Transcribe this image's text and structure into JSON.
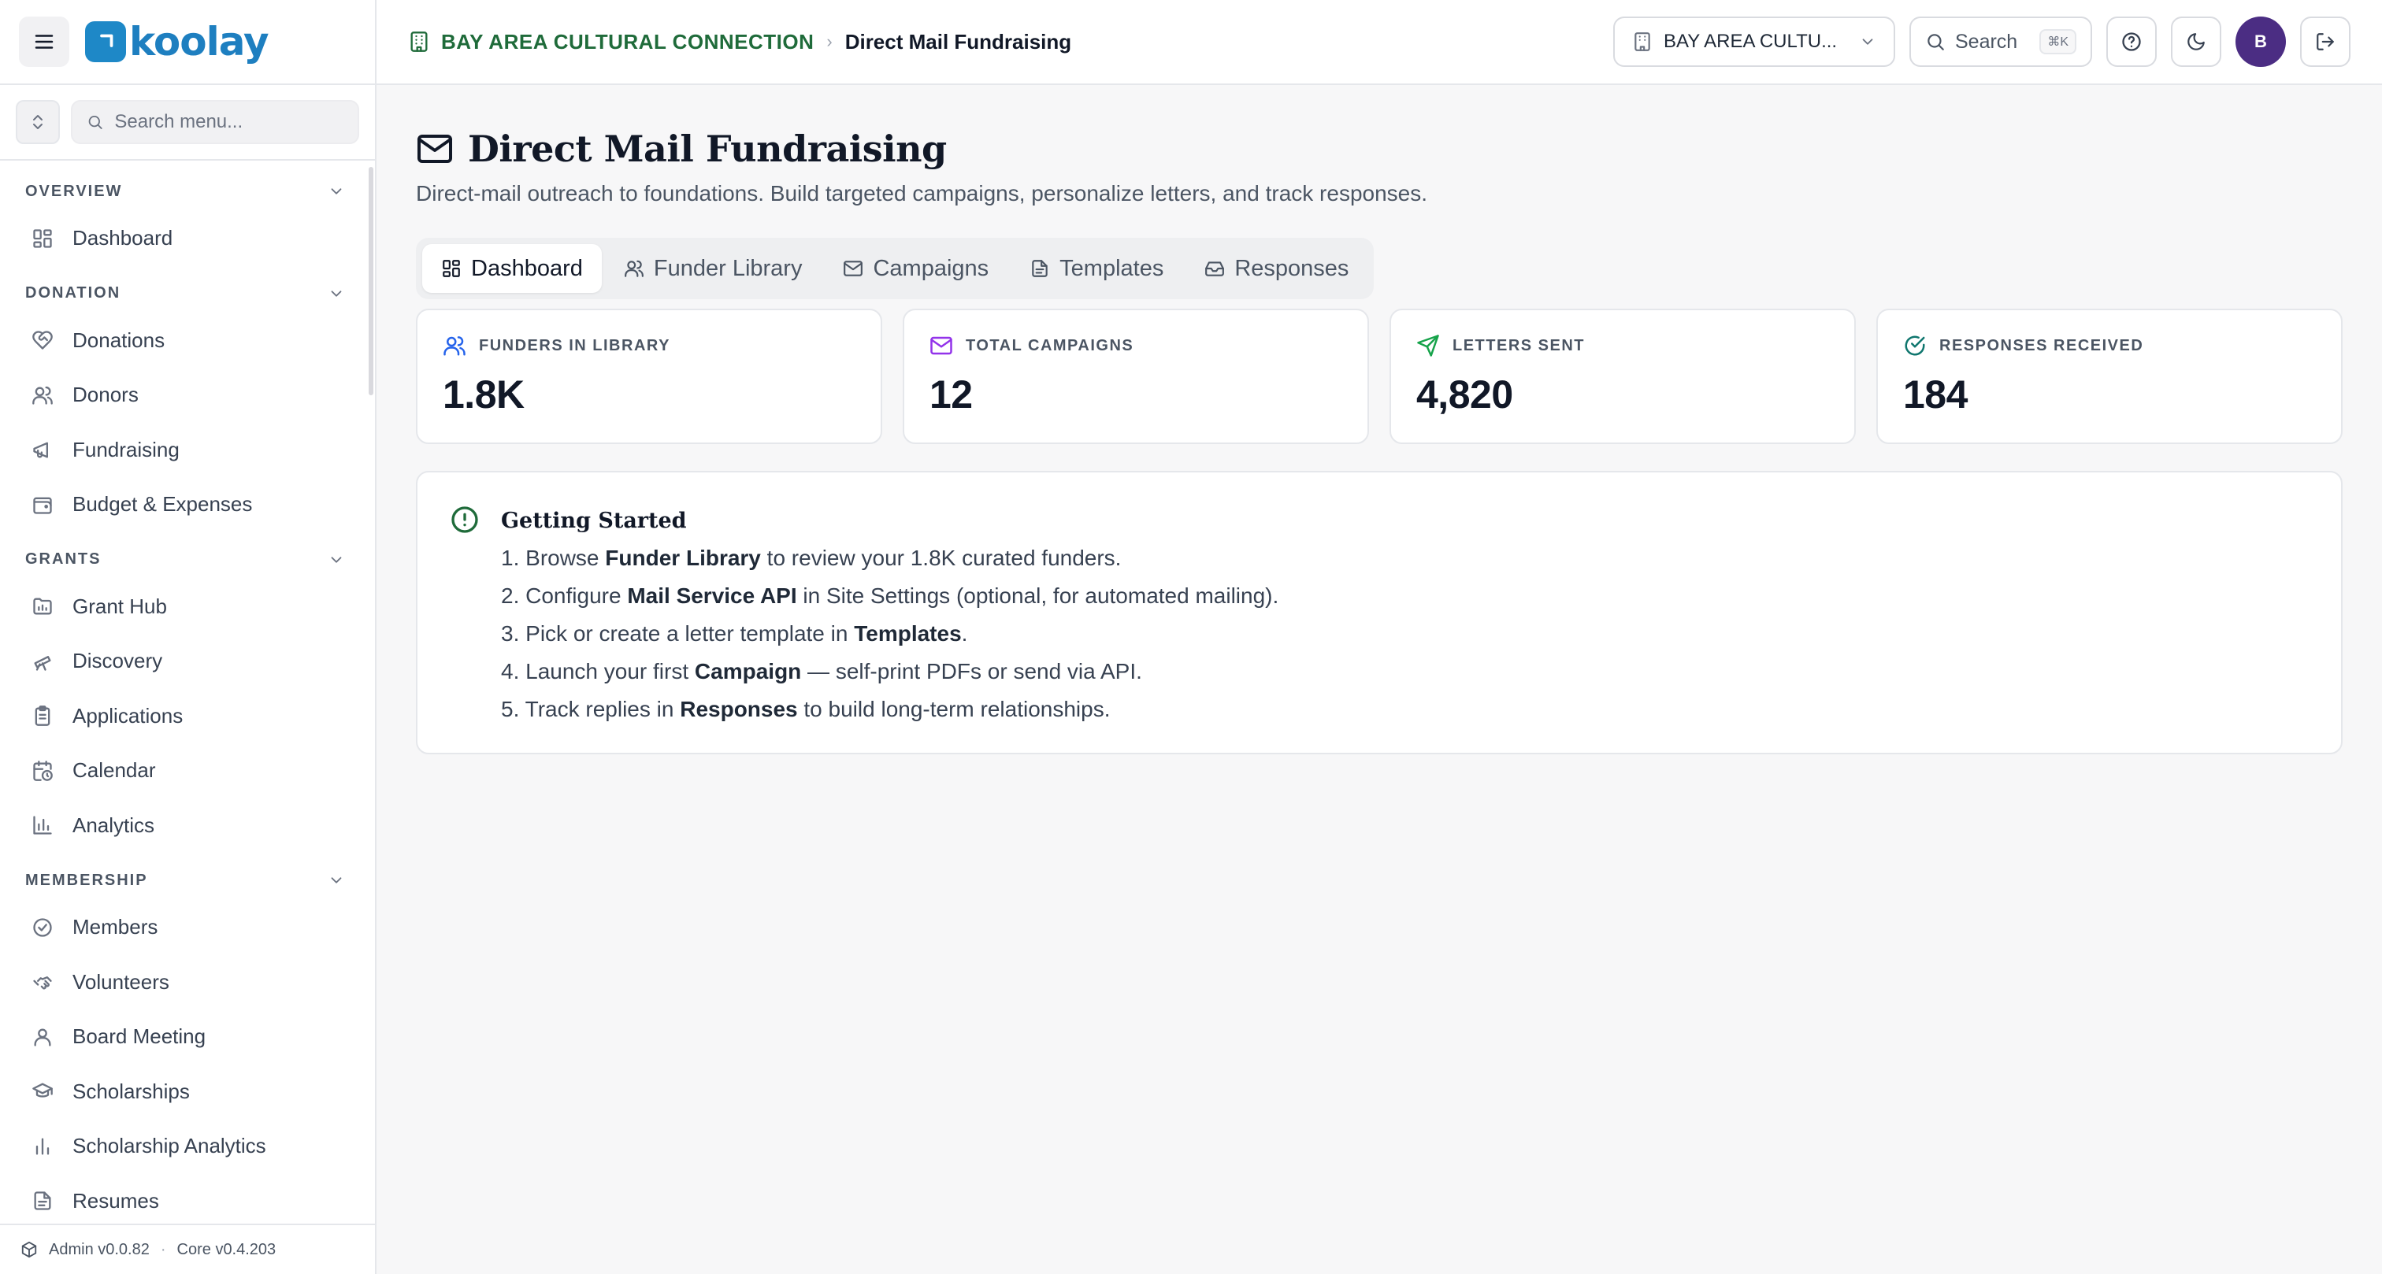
{
  "brand": {
    "name": "koolay"
  },
  "sidebar": {
    "search_placeholder": "Search menu...",
    "sections": [
      {
        "title": "OVERVIEW",
        "items": [
          {
            "label": "Dashboard",
            "icon": "grid-icon"
          }
        ]
      },
      {
        "title": "DONATION",
        "items": [
          {
            "label": "Donations",
            "icon": "heart-handshake-icon"
          },
          {
            "label": "Donors",
            "icon": "users-icon"
          },
          {
            "label": "Fundraising",
            "icon": "megaphone-icon"
          },
          {
            "label": "Budget & Expenses",
            "icon": "wallet-icon"
          }
        ]
      },
      {
        "title": "GRANTS",
        "items": [
          {
            "label": "Grant Hub",
            "icon": "folder-icon"
          },
          {
            "label": "Discovery",
            "icon": "telescope-icon"
          },
          {
            "label": "Applications",
            "icon": "clipboard-icon"
          },
          {
            "label": "Calendar",
            "icon": "calendar-clock-icon"
          },
          {
            "label": "Analytics",
            "icon": "bar-chart-icon"
          }
        ]
      },
      {
        "title": "MEMBERSHIP",
        "items": [
          {
            "label": "Members",
            "icon": "badge-check-icon"
          },
          {
            "label": "Volunteers",
            "icon": "handshake-icon"
          },
          {
            "label": "Board Meeting",
            "icon": "user-icon"
          },
          {
            "label": "Scholarships",
            "icon": "graduation-cap-icon"
          },
          {
            "label": "Scholarship Analytics",
            "icon": "bar-chart-icon"
          },
          {
            "label": "Resumes",
            "icon": "file-icon"
          }
        ]
      }
    ],
    "footer": {
      "admin_version": "Admin v0.0.82",
      "separator": "·",
      "core_version": "Core v0.4.203"
    }
  },
  "topbar": {
    "org": "BAY AREA CULTURAL CONNECTION",
    "breadcrumb_sep": "›",
    "page": "Direct Mail Fundraising",
    "org_select": "BAY AREA CULTU...",
    "search_label": "Search",
    "search_shortcut": "⌘K",
    "avatar_initial": "B"
  },
  "main": {
    "title": "Direct Mail Fundraising",
    "subtitle": "Direct-mail outreach to foundations. Build targeted campaigns, personalize letters, and track responses.",
    "tabs": [
      {
        "label": "Dashboard",
        "active": true
      },
      {
        "label": "Funder Library",
        "active": false
      },
      {
        "label": "Campaigns",
        "active": false
      },
      {
        "label": "Templates",
        "active": false
      },
      {
        "label": "Responses",
        "active": false
      }
    ],
    "stats": [
      {
        "label": "FUNDERS IN LIBRARY",
        "value": "1.8K",
        "color": "#2563eb"
      },
      {
        "label": "TOTAL CAMPAIGNS",
        "value": "12",
        "color": "#9333ea"
      },
      {
        "label": "LETTERS SENT",
        "value": "4,820",
        "color": "#16a34a"
      },
      {
        "label": "RESPONSES RECEIVED",
        "value": "184",
        "color": "#0f766e"
      }
    ],
    "getting_started": {
      "title": "Getting Started",
      "steps": [
        {
          "num": "1.",
          "pre": "Browse ",
          "bold": "Funder Library",
          "post": " to review your 1.8K curated funders."
        },
        {
          "num": "2.",
          "pre": "Configure ",
          "bold": "Mail Service API",
          "post": " in Site Settings (optional, for automated mailing)."
        },
        {
          "num": "3.",
          "pre": "Pick or create a letter template in ",
          "bold": "Templates",
          "post": "."
        },
        {
          "num": "4.",
          "pre": "Launch your first ",
          "bold": "Campaign",
          "post": " — self-print PDFs or send via API."
        },
        {
          "num": "5.",
          "pre": "Track replies in ",
          "bold": "Responses",
          "post": " to build long-term relationships."
        }
      ]
    }
  }
}
